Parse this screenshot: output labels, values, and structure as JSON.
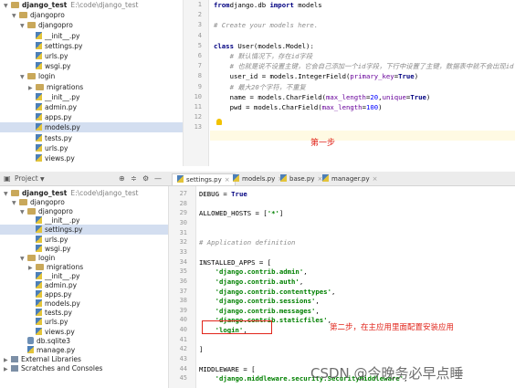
{
  "panel1": {
    "tree": [
      {
        "label": "django_test",
        "path": "E:\\code\\django_test",
        "kind": "folder",
        "arrow": "▼",
        "indent": 0,
        "bold": true
      },
      {
        "label": "djangopro",
        "kind": "folder",
        "arrow": "▼",
        "indent": 1
      },
      {
        "label": "djangopro",
        "kind": "folder",
        "arrow": "▼",
        "indent": 2
      },
      {
        "label": "__init__.py",
        "kind": "py",
        "arrow": "",
        "indent": 3
      },
      {
        "label": "settings.py",
        "kind": "py",
        "arrow": "",
        "indent": 3
      },
      {
        "label": "urls.py",
        "kind": "py",
        "arrow": "",
        "indent": 3
      },
      {
        "label": "wsgi.py",
        "kind": "py",
        "arrow": "",
        "indent": 3
      },
      {
        "label": "login",
        "kind": "folder",
        "arrow": "▼",
        "indent": 2
      },
      {
        "label": "migrations",
        "kind": "folder",
        "arrow": "▶",
        "indent": 3
      },
      {
        "label": "__init__.py",
        "kind": "py",
        "arrow": "",
        "indent": 3
      },
      {
        "label": "admin.py",
        "kind": "py",
        "arrow": "",
        "indent": 3
      },
      {
        "label": "apps.py",
        "kind": "py",
        "arrow": "",
        "indent": 3
      },
      {
        "label": "models.py",
        "kind": "py",
        "arrow": "",
        "indent": 3,
        "selected": true
      },
      {
        "label": "tests.py",
        "kind": "py",
        "arrow": "",
        "indent": 3
      },
      {
        "label": "urls.py",
        "kind": "py",
        "arrow": "",
        "indent": 3
      },
      {
        "label": "views.py",
        "kind": "py",
        "arrow": "",
        "indent": 3
      }
    ],
    "code": [
      {
        "n": "1",
        "segs": [
          [
            "kw",
            "from"
          ],
          [
            "",
            "django.db "
          ],
          [
            "kw",
            "import"
          ],
          [
            "",
            " models"
          ]
        ]
      },
      {
        "n": "2",
        "segs": []
      },
      {
        "n": "3",
        "segs": [
          [
            "cm",
            "# Create your models here."
          ]
        ]
      },
      {
        "n": "4",
        "segs": []
      },
      {
        "n": "5",
        "segs": [
          [
            "kw",
            "class"
          ],
          [
            "",
            " User(models.Model):"
          ]
        ]
      },
      {
        "n": "6",
        "segs": [
          [
            "cm",
            "    # 默认情况下，存在id字段"
          ]
        ]
      },
      {
        "n": "7",
        "segs": [
          [
            "cm",
            "    # 也就是说不设置主键，它会自己添加一个id字段，下行中设置了主键，数据表中就不会出现id"
          ]
        ]
      },
      {
        "n": "8",
        "segs": [
          [
            "",
            "    user_id = models.IntegerField("
          ],
          [
            "kwarg",
            "primary_key"
          ],
          [
            "",
            "="
          ],
          [
            "kw",
            "True"
          ],
          [
            "",
            ")"
          ]
        ]
      },
      {
        "n": "9",
        "segs": [
          [
            "cm",
            "    # 最大20个字符，不重复"
          ]
        ]
      },
      {
        "n": "10",
        "segs": [
          [
            "",
            "    name = models.CharField("
          ],
          [
            "kwarg",
            "max_length"
          ],
          [
            "",
            "="
          ],
          [
            "num",
            "20"
          ],
          [
            "",
            ","
          ],
          [
            "kwarg",
            "unique"
          ],
          [
            "",
            "="
          ],
          [
            "kw",
            "True"
          ],
          [
            "",
            ")"
          ]
        ]
      },
      {
        "n": "11",
        "segs": [
          [
            "",
            "    pwd = models.CharField("
          ],
          [
            "kwarg",
            "max_length"
          ],
          [
            "",
            "="
          ],
          [
            "num",
            "100"
          ],
          [
            "",
            ")"
          ]
        ]
      },
      {
        "n": "12",
        "segs": []
      },
      {
        "n": "13",
        "segs": []
      }
    ],
    "annotation": "第一步"
  },
  "panel2": {
    "toolbar": {
      "project_label": "Project",
      "buttons": [
        "⊕",
        "≑",
        "⚙",
        "—"
      ]
    },
    "tabs": [
      {
        "label": "settings.py",
        "active": true
      },
      {
        "label": "models.py",
        "active": false
      },
      {
        "label": "base.py",
        "active": false
      },
      {
        "label": "manager.py",
        "active": false
      }
    ],
    "tree": [
      {
        "label": "django_test",
        "path": "E:\\code\\django_test",
        "kind": "folder",
        "arrow": "▼",
        "indent": 0,
        "bold": true
      },
      {
        "label": "djangopro",
        "kind": "folder",
        "arrow": "▼",
        "indent": 1
      },
      {
        "label": "djangopro",
        "kind": "folder",
        "arrow": "▼",
        "indent": 2
      },
      {
        "label": "__init__.py",
        "kind": "py",
        "arrow": "",
        "indent": 3
      },
      {
        "label": "settings.py",
        "kind": "py",
        "arrow": "",
        "indent": 3,
        "selected": true
      },
      {
        "label": "urls.py",
        "kind": "py",
        "arrow": "",
        "indent": 3
      },
      {
        "label": "wsgi.py",
        "kind": "py",
        "arrow": "",
        "indent": 3
      },
      {
        "label": "login",
        "kind": "folder",
        "arrow": "▼",
        "indent": 2
      },
      {
        "label": "migrations",
        "kind": "folder",
        "arrow": "▶",
        "indent": 3
      },
      {
        "label": "__init__.py",
        "kind": "py",
        "arrow": "",
        "indent": 3
      },
      {
        "label": "admin.py",
        "kind": "py",
        "arrow": "",
        "indent": 3
      },
      {
        "label": "apps.py",
        "kind": "py",
        "arrow": "",
        "indent": 3
      },
      {
        "label": "models.py",
        "kind": "py",
        "arrow": "",
        "indent": 3
      },
      {
        "label": "tests.py",
        "kind": "py",
        "arrow": "",
        "indent": 3
      },
      {
        "label": "urls.py",
        "kind": "py",
        "arrow": "",
        "indent": 3
      },
      {
        "label": "views.py",
        "kind": "py",
        "arrow": "",
        "indent": 3
      },
      {
        "label": "db.sqlite3",
        "kind": "db",
        "arrow": "",
        "indent": 2
      },
      {
        "label": "manage.py",
        "kind": "py",
        "arrow": "",
        "indent": 2
      },
      {
        "label": "External Libraries",
        "kind": "lib",
        "arrow": "▶",
        "indent": 0
      },
      {
        "label": "Scratches and Consoles",
        "kind": "lib",
        "arrow": "▶",
        "indent": 0
      }
    ],
    "code": [
      {
        "n": "27",
        "segs": [
          [
            "",
            "DEBUG = "
          ],
          [
            "kw",
            "True"
          ]
        ]
      },
      {
        "n": "28",
        "segs": []
      },
      {
        "n": "29",
        "segs": [
          [
            "",
            "ALLOWED_HOSTS = ["
          ],
          [
            "str",
            "'*'"
          ],
          [
            "",
            "]"
          ]
        ]
      },
      {
        "n": "30",
        "segs": []
      },
      {
        "n": "31",
        "segs": []
      },
      {
        "n": "32",
        "segs": [
          [
            "cm",
            "# Application definition"
          ]
        ]
      },
      {
        "n": "33",
        "segs": []
      },
      {
        "n": "34",
        "segs": [
          [
            "",
            "INSTALLED_APPS = ["
          ]
        ]
      },
      {
        "n": "35",
        "segs": [
          [
            "str",
            "    'django.contrib.admin'"
          ],
          [
            "",
            ","
          ]
        ]
      },
      {
        "n": "36",
        "segs": [
          [
            "str",
            "    'django.contrib.auth'"
          ],
          [
            "",
            ","
          ]
        ]
      },
      {
        "n": "37",
        "segs": [
          [
            "str",
            "    'django.contrib.contenttypes'"
          ],
          [
            "",
            ","
          ]
        ]
      },
      {
        "n": "38",
        "segs": [
          [
            "str",
            "    'django.contrib.sessions'"
          ],
          [
            "",
            ","
          ]
        ]
      },
      {
        "n": "39",
        "segs": [
          [
            "str",
            "    'django.contrib.messages'"
          ],
          [
            "",
            ","
          ]
        ]
      },
      {
        "n": "40",
        "segs": [
          [
            "str",
            "    'django.contrib.staticfiles'"
          ],
          [
            "",
            ","
          ]
        ]
      },
      {
        "n": "40",
        "segs": [
          [
            "str",
            "    'login'"
          ],
          [
            "",
            ","
          ]
        ]
      },
      {
        "n": "41",
        "segs": []
      },
      {
        "n": "42",
        "segs": [
          [
            "",
            "]"
          ]
        ]
      },
      {
        "n": "43",
        "segs": []
      },
      {
        "n": "44",
        "segs": [
          [
            "",
            "MIDDLEWARE = ["
          ]
        ]
      },
      {
        "n": "45",
        "segs": [
          [
            "str",
            "    'django.middleware.security.SecurityMiddleware'"
          ],
          [
            "",
            ","
          ]
        ]
      }
    ],
    "annotation": "第二步，在主应用里面配置安装应用",
    "watermark": "CSDN @今晚务必早点睡"
  }
}
